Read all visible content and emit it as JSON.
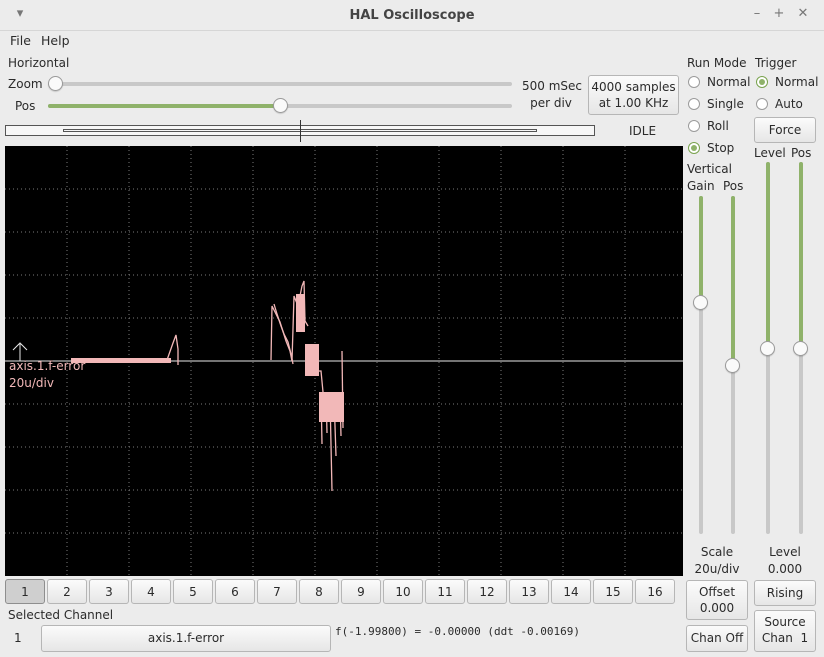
{
  "window": {
    "title": "HAL Oscilloscope",
    "minimize": "–",
    "maximize": "+",
    "close": "✕"
  },
  "menu": {
    "file": "File",
    "help": "Help"
  },
  "horizontal": {
    "section": "Horizontal",
    "zoom_label": "Zoom",
    "pos_label": "Pos",
    "rate_line1": "500 mSec",
    "rate_line2": "per div",
    "samples_line1": "4000 samples",
    "samples_line2": "at 1.00 KHz",
    "zoom_level": 0.0,
    "pos_level": 0.5
  },
  "status": "IDLE",
  "run_mode": {
    "label": "Run Mode",
    "options": [
      "Normal",
      "Single",
      "Roll",
      "Stop"
    ],
    "selected": "Stop"
  },
  "trigger": {
    "label": "Trigger",
    "options": [
      "Normal",
      "Auto"
    ],
    "selected": "Normal",
    "force": "Force",
    "level_label": "Level",
    "pos_label": "Pos",
    "level_value_label": "Level",
    "level_value": "0.000",
    "edge": "Rising",
    "source_line1": "Source",
    "source_line2": "Chan  1"
  },
  "vertical": {
    "label": "Vertical",
    "gain_label": "Gain",
    "pos_label": "Pos",
    "scale_label": "Scale",
    "scale_value": "20u/div",
    "offset_label": "Offset",
    "offset_value": "0.000",
    "chan_off": "Chan Off"
  },
  "trace": {
    "name": "axis.1.f-error",
    "scale": "20u/div",
    "color": "#f2b8b8"
  },
  "channels": [
    "1",
    "2",
    "3",
    "4",
    "5",
    "6",
    "7",
    "8",
    "9",
    "10",
    "11",
    "12",
    "13",
    "14",
    "15",
    "16"
  ],
  "selected_channel": {
    "label": "Selected Channel",
    "number": "1",
    "name": "axis.1.f-error",
    "readout": "f(-1.99800) = -0.00000 (ddt -0.00169)"
  }
}
